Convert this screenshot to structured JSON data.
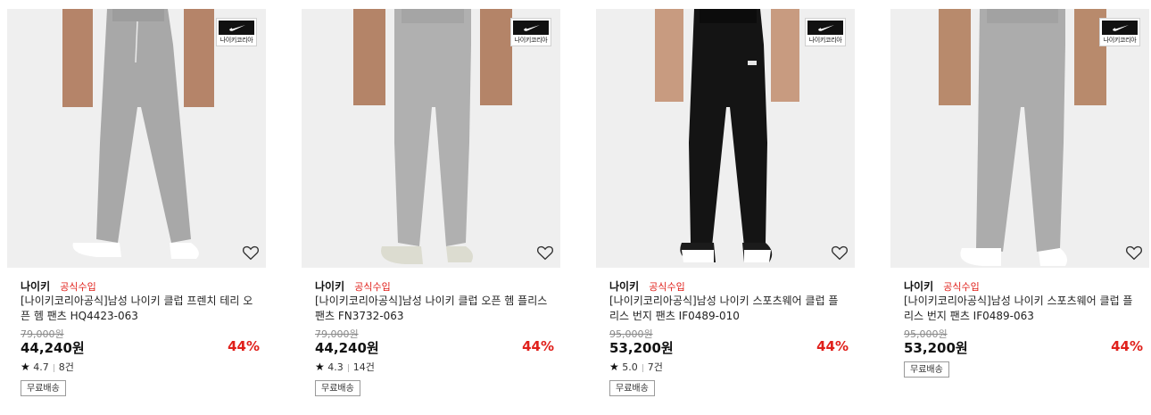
{
  "badge_text": "나이키코리아",
  "colors": {
    "accent_red": "#e0201b",
    "image_bg": "#eeeeee"
  },
  "icons": {
    "wishlist": "heart-outline-icon",
    "brand_logo": "nike-swoosh-icon",
    "rating": "star-icon"
  },
  "products": [
    {
      "brand": "나이키",
      "official": "공식수입",
      "title": "[나이키코리아공식]남성 나이키 클럽 프렌치 테리 오픈 헴 팬츠 HQ4423-063",
      "original_price": "79,000원",
      "sale_price": "44,240원",
      "discount": "44%",
      "rating": "4.7",
      "reviews": "8건",
      "shipping": "무료배송"
    },
    {
      "brand": "나이키",
      "official": "공식수입",
      "title": "[나이키코리아공식]남성 나이키 클럽 오픈 헴 플리스 팬츠 FN3732-063",
      "original_price": "79,000원",
      "sale_price": "44,240원",
      "discount": "44%",
      "rating": "4.3",
      "reviews": "14건",
      "shipping": "무료배송"
    },
    {
      "brand": "나이키",
      "official": "공식수입",
      "title": "[나이키코리아공식]남성 나이키 스포츠웨어 클럽 플리스 번지 팬츠 IF0489-010",
      "original_price": "95,000원",
      "sale_price": "53,200원",
      "discount": "44%",
      "rating": "5.0",
      "reviews": "7건",
      "shipping": "무료배송"
    },
    {
      "brand": "나이키",
      "official": "공식수입",
      "title": "[나이키코리아공식]남성 나이키 스포츠웨어 클럽 플리스 번지 팬츠 IF0489-063",
      "original_price": "95,000원",
      "sale_price": "53,200원",
      "discount": "44%",
      "shipping": "무료배송"
    }
  ]
}
